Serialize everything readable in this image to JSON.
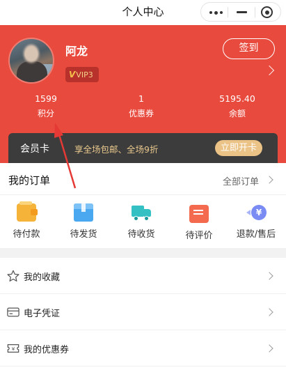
{
  "nav": {
    "title": "个人中心"
  },
  "profile": {
    "username": "阿龙",
    "vip_badge": "VIP3",
    "vip_mark": "V",
    "checkin_label": "签到"
  },
  "stats": [
    {
      "value": "1599",
      "label": "积分"
    },
    {
      "value": "1",
      "label": "优惠券"
    },
    {
      "value": "5195.40",
      "label": "余额"
    }
  ],
  "member_card": {
    "title": "会员卡",
    "desc": "享全场包邮、全场9折",
    "button": "立即开卡"
  },
  "orders": {
    "title": "我的订单",
    "all_label": "全部订单",
    "items": [
      {
        "label": "待付款",
        "icon": "wallet-icon"
      },
      {
        "label": "待发货",
        "icon": "box-icon"
      },
      {
        "label": "待收货",
        "icon": "truck-icon"
      },
      {
        "label": "待评价",
        "icon": "comment-icon"
      },
      {
        "label": "退款/售后",
        "icon": "refund-icon",
        "symbol": "¥"
      }
    ]
  },
  "menu": [
    {
      "label": "我的收藏",
      "icon": "star-icon"
    },
    {
      "label": "电子凭证",
      "icon": "card-icon"
    },
    {
      "label": "我的优惠券",
      "icon": "coupon-icon"
    }
  ],
  "colors": {
    "header_red": "#e84a3d",
    "member_dark": "#3c3c3c",
    "gold": "#ecc386",
    "annotation_arrow": "#e53935"
  }
}
